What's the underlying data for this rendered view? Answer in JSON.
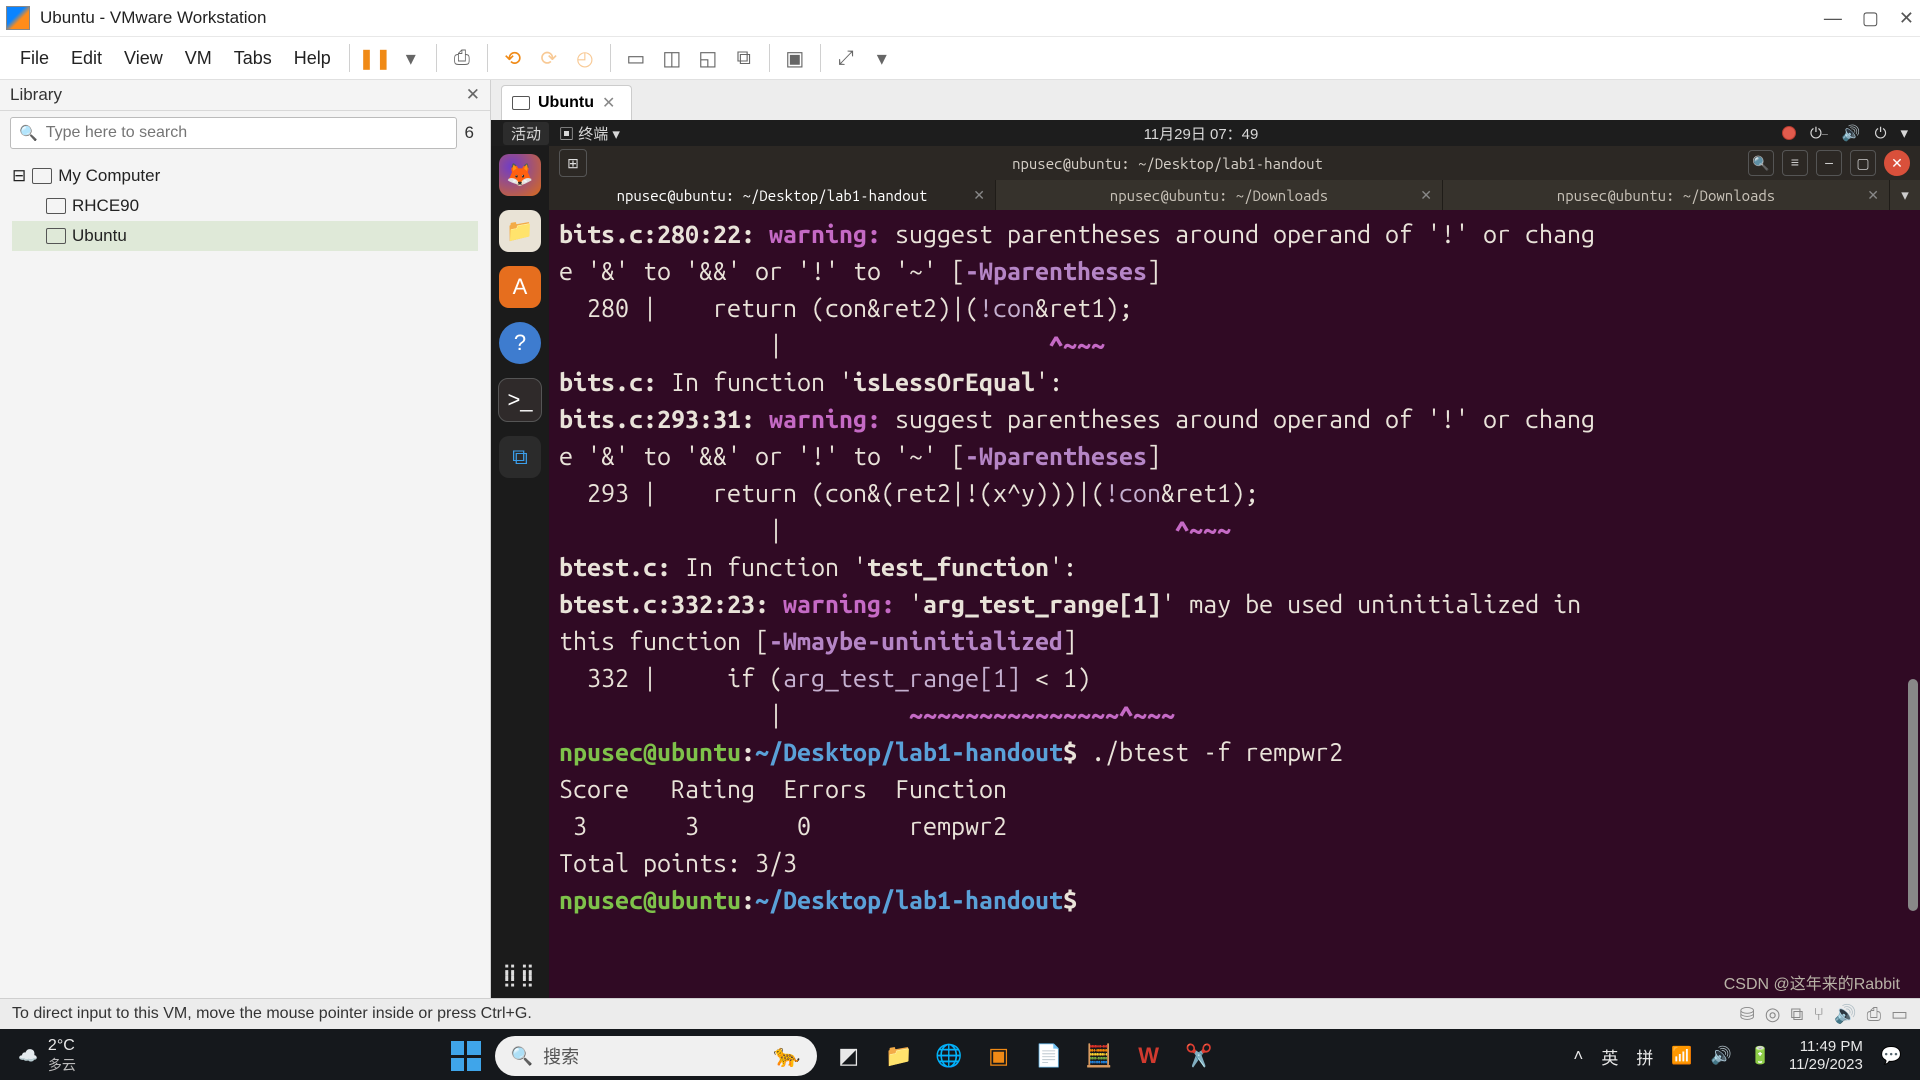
{
  "window": {
    "title": "Ubuntu - VMware Workstation"
  },
  "menubar": [
    "File",
    "Edit",
    "View",
    "VM",
    "Tabs",
    "Help"
  ],
  "library": {
    "title": "Library",
    "search_placeholder": "Type here to search",
    "search_count": "6",
    "root": "My Computer",
    "items": [
      "RHCE90",
      "Ubuntu"
    ],
    "selected": "Ubuntu"
  },
  "vm_tab": {
    "label": "Ubuntu"
  },
  "gnome": {
    "activities": "活动",
    "terminal_label": "终端",
    "datetime": "11月29日 07：49"
  },
  "terminal": {
    "title": "npusec@ubuntu: ~/Desktop/lab1-handout",
    "tabs": [
      {
        "label": "npusec@ubuntu: ~/Desktop/lab1-handout",
        "active": true
      },
      {
        "label": "npusec@ubuntu: ~/Downloads",
        "active": false
      },
      {
        "label": "npusec@ubuntu: ~/Downloads",
        "active": false
      }
    ],
    "output": {
      "l1_file": "bits.c:280:22: ",
      "l1_warn": "warning: ",
      "l1_msg1": "suggest parentheses around operand of '!' or chang",
      "l1_msg2": "e '&' to '&&' or '!' to '~' [",
      "l1_flag": "-Wparentheses",
      "l1_msg3": "]",
      "l2_code": "  280 |    return (con&ret2)|(",
      "l2_id": "!con",
      "l2_code2": "&ret1);",
      "l3": "               |                   ",
      "l3_caret": "^~~~",
      "l4_a": "bits.c:",
      "l4_b": " In function '",
      "l4_c": "isLessOrEqual",
      "l4_d": "':",
      "l5_file": "bits.c:293:31: ",
      "l5_warn": "warning: ",
      "l5_msg1": "suggest parentheses around operand of '!' or chang",
      "l5_msg2": "e '&' to '&&' or '!' to '~' [",
      "l5_flag": "-Wparentheses",
      "l5_msg3": "]",
      "l6_code": "  293 |    return (con&(ret2|!(x^y)))|(",
      "l6_id": "!con",
      "l6_code2": "&ret1);",
      "l7": "               |                            ",
      "l7_caret": "^~~~",
      "l8_a": "btest.c:",
      "l8_b": " In function '",
      "l8_c": "test_function",
      "l8_d": "':",
      "l9_file": "btest.c:332:23: ",
      "l9_warn": "warning: ",
      "l9_msg1": "'",
      "l9_id": "arg_test_range[1]",
      "l9_msg2": "' may be used uninitialized in ",
      "l10_a": "this function [",
      "l10_flag": "-Wmaybe-uninitialized",
      "l10_b": "]",
      "l11_code": "  332 |     if (",
      "l11_id": "arg_test_range[1]",
      "l11_code2": " < 1)",
      "l12": "               |         ",
      "l12_caret": "~~~~~~~~~~~~~~~^~~~",
      "prompt_user": "npusec@ubuntu",
      "prompt_sep": ":",
      "prompt_path": "~/Desktop/lab1-handout",
      "prompt_dollar": "$",
      "cmd1": " ./btest -f rempwr2",
      "hdr": "Score   Rating  Errors  Function",
      "row": " 3       3       0       rempwr2",
      "total": "Total points: 3/3"
    }
  },
  "statusbar": {
    "hint": "To direct input to this VM, move the mouse pointer inside or press Ctrl+G."
  },
  "win_taskbar": {
    "weather_temp": "2°C",
    "weather_desc": "多云",
    "search_placeholder": "搜索",
    "ime_lang": "英",
    "ime_mode": "拼",
    "clock_time": "11:49 PM",
    "clock_date": "11/29/2023"
  },
  "watermark": "CSDN @这年来的Rabbit"
}
